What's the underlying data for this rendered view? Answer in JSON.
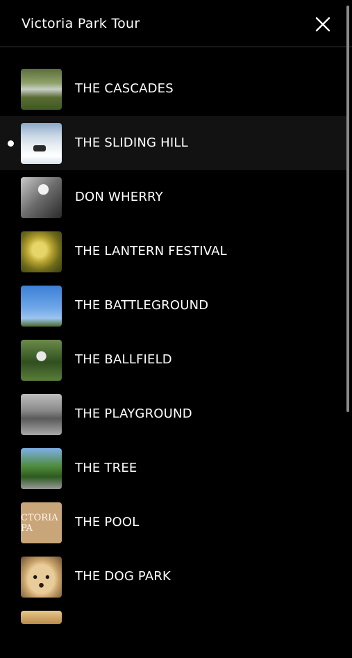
{
  "header": {
    "title": "Victoria Park Tour"
  },
  "tour": {
    "active_index": 1,
    "stops": [
      {
        "label": "THE CASCADES",
        "thumb": "cascades-photo"
      },
      {
        "label": "THE SLIDING HILL",
        "thumb": "sliding-hill-photo"
      },
      {
        "label": "DON WHERRY",
        "thumb": "statue-photo"
      },
      {
        "label": "THE LANTERN FESTIVAL",
        "thumb": "lantern-photo"
      },
      {
        "label": "THE BATTLEGROUND",
        "thumb": "battleground-photo"
      },
      {
        "label": "THE BALLFIELD",
        "thumb": "ballfield-photo"
      },
      {
        "label": "THE PLAYGROUND",
        "thumb": "playground-photo"
      },
      {
        "label": "THE TREE",
        "thumb": "tree-photo"
      },
      {
        "label": "THE POOL",
        "thumb": "pool-sign-photo",
        "thumb_text": "CTORIA PA"
      },
      {
        "label": "THE DOG PARK",
        "thumb": "dog-photo"
      }
    ]
  },
  "icons": {
    "close": "close-icon",
    "active": "current-stop-dot-icon"
  },
  "colors": {
    "background": "#000000",
    "text": "#ffffff",
    "active_row": "#121212",
    "divider": "#3a3a3a"
  }
}
